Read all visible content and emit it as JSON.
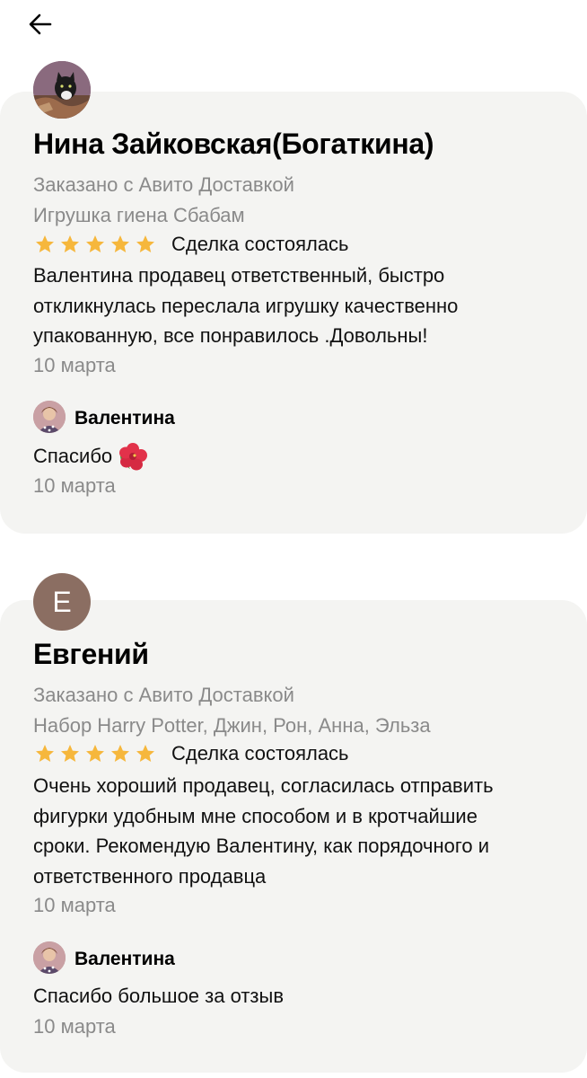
{
  "header": {
    "back_icon": "arrow-left-icon"
  },
  "reviews": [
    {
      "avatar_icon": "cat-photo-avatar",
      "name": "Нина Зайковская(Богаткина)",
      "delivery": "Заказано с Авито Доставкой",
      "item": "Игрушка гиена Сбабам",
      "rating": 5,
      "deal_status": "Сделка состоялась",
      "text_lines": [
        "Валентина продавец  ответственный, быстро",
        "откликнулась переслала игрушку качественно",
        "упакованную, все понравилось .Довольны!"
      ],
      "date": "10 марта",
      "reply": {
        "author": "Валентина",
        "text": "Спасибо",
        "emoji": "hibiscus-icon",
        "date": "10 марта"
      }
    },
    {
      "avatar_letter": "Е",
      "name": "Евгений",
      "delivery": "Заказано с Авито Доставкой",
      "item": "Набор Harry Potter, Джин, Рон, Анна, Эльза",
      "rating": 5,
      "deal_status": "Сделка состоялась",
      "text_lines": [
        "Очень хороший продавец, согласилась отправить",
        "фигурки удобным мне способом и в кротчайшие",
        "сроки. Рекомендую Валентину, как порядочного и",
        "ответственного продавца"
      ],
      "date": "10 марта",
      "reply": {
        "author": "Валентина",
        "text": "Спасибо большое за отзыв",
        "date": "10 марта"
      }
    }
  ],
  "colors": {
    "card_bg": "#f4f4f2",
    "star": "#f6b73c",
    "muted": "#8a8a8a",
    "avatar_letter_bg": "#8b6e62"
  }
}
